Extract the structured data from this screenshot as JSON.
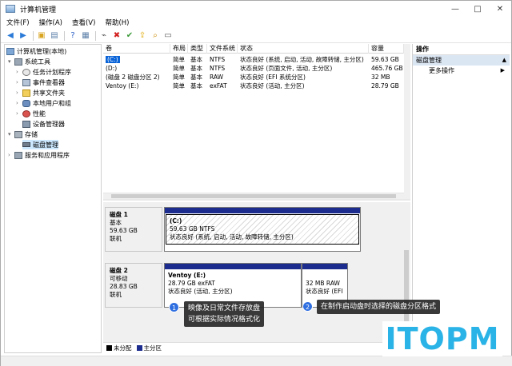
{
  "window": {
    "title": "计算机管理",
    "controls": {
      "minimize": "—",
      "maximize": "□",
      "close": "✕"
    }
  },
  "menu": [
    "文件(F)",
    "操作(A)",
    "查看(V)",
    "帮助(H)"
  ],
  "tree": {
    "root": "计算机管理(本地)",
    "system_tools": "系统工具",
    "task_scheduler": "任务计划程序",
    "event_viewer": "事件查看器",
    "shared_folders": "共享文件夹",
    "local_users": "本地用户和组",
    "performance": "性能",
    "device_manager": "设备管理器",
    "storage": "存储",
    "disk_management": "磁盘管理",
    "services": "服务和应用程序"
  },
  "volume_table": {
    "headers": [
      "卷",
      "布局",
      "类型",
      "文件系统",
      "状态",
      "容量"
    ],
    "rows": [
      {
        "name": "(C:)",
        "layout": "简单",
        "type": "基本",
        "fs": "NTFS",
        "status": "状态良好 (系统, 启动, 活动, 故障转储, 主分区)",
        "capacity": "59.63 GB"
      },
      {
        "name": "(D:)",
        "layout": "简单",
        "type": "基本",
        "fs": "NTFS",
        "status": "状态良好 (页面文件, 活动, 主分区)",
        "capacity": "465.76 GB"
      },
      {
        "name": "(磁盘 2 磁盘分区 2)",
        "layout": "简单",
        "type": "基本",
        "fs": "RAW",
        "status": "状态良好 (EFI 系统分区)",
        "capacity": "32 MB"
      },
      {
        "name": "Ventoy (E:)",
        "layout": "简单",
        "type": "基本",
        "fs": "exFAT",
        "status": "状态良好 (活动, 主分区)",
        "capacity": "28.79 GB"
      }
    ]
  },
  "disks": [
    {
      "name": "磁盘 1",
      "kind": "基本",
      "size": "59.63 GB",
      "state": "联机",
      "partitions": [
        {
          "title": "(C:)",
          "size_fs": "59.63 GB NTFS",
          "status": "状态良好 (系统, 启动, 活动, 故障转储, 主分区)"
        }
      ]
    },
    {
      "name": "磁盘 2",
      "kind": "可移动",
      "size": "28.83 GB",
      "state": "联机",
      "partitions": [
        {
          "title": "Ventoy  (E:)",
          "size_fs": "28.79 GB exFAT",
          "status": "状态良好 (活动, 主分区)"
        },
        {
          "title": "",
          "size_fs": "32 MB RAW",
          "status": "状态良好 (EFI"
        }
      ]
    }
  ],
  "legend": [
    {
      "label": "未分配",
      "color": "#000000"
    },
    {
      "label": "主分区",
      "color": "#1c2c8e"
    }
  ],
  "actions": {
    "header": "操作",
    "section": "磁盘管理",
    "more": "更多操作"
  },
  "callouts": [
    {
      "badge": "1",
      "line1": "映像及日常文件存放盘",
      "line2": "可根据实际情况格式化"
    },
    {
      "badge": "2",
      "line1": "在制作启动盘时选择的磁盘分区格式"
    }
  ],
  "watermark": "ITOPM",
  "colors": {
    "primary_partition": "#1c2c8e",
    "selection": "#0a64d8",
    "badge": "#2f6fe0",
    "watermark": "#2ab3e6"
  }
}
